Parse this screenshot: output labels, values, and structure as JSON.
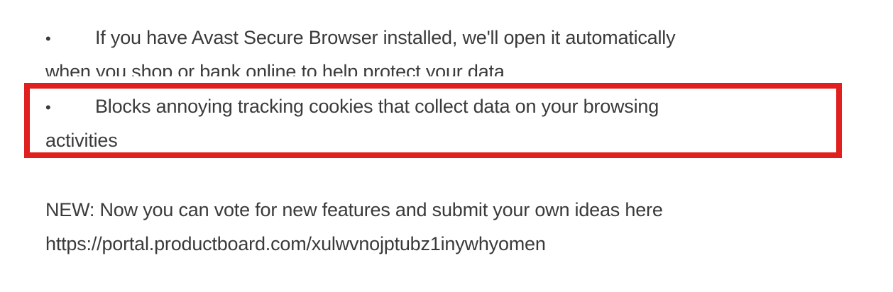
{
  "features": {
    "items": [
      {
        "bullet": "•",
        "line1": "If you have Avast Secure Browser installed, we'll open it automatically",
        "line2": "when you shop or bank online to help protect your data"
      },
      {
        "bullet": "•",
        "line1": "Blocks annoying tracking cookies that collect data on your browsing",
        "line2": "activities"
      }
    ],
    "highlight_color": "#e01f1f"
  },
  "news": {
    "line1": "NEW: Now you can vote for new features and submit your own ideas here",
    "link": "https://portal.productboard.com/xulwvnojptubz1inywhyomen"
  }
}
